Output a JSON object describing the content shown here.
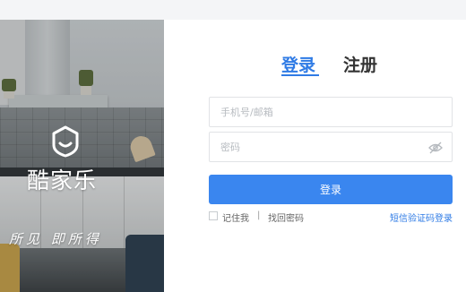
{
  "brand": {
    "name": "酷家乐",
    "slogan": "所见 即所得"
  },
  "tabs": {
    "login": "登录",
    "register": "注册"
  },
  "form": {
    "phone_placeholder": "手机号/邮箱",
    "password_placeholder": "密码",
    "submit_label": "登录"
  },
  "options": {
    "remember": "记住我",
    "separator": "|",
    "forgot": "找回密码",
    "sms_login": "短信验证码登录"
  },
  "colors": {
    "accent": "#2f7be5",
    "button": "#3a86ef"
  },
  "icons": {
    "logo": "shield-face-icon",
    "password_toggle": "eye-slash-icon"
  }
}
